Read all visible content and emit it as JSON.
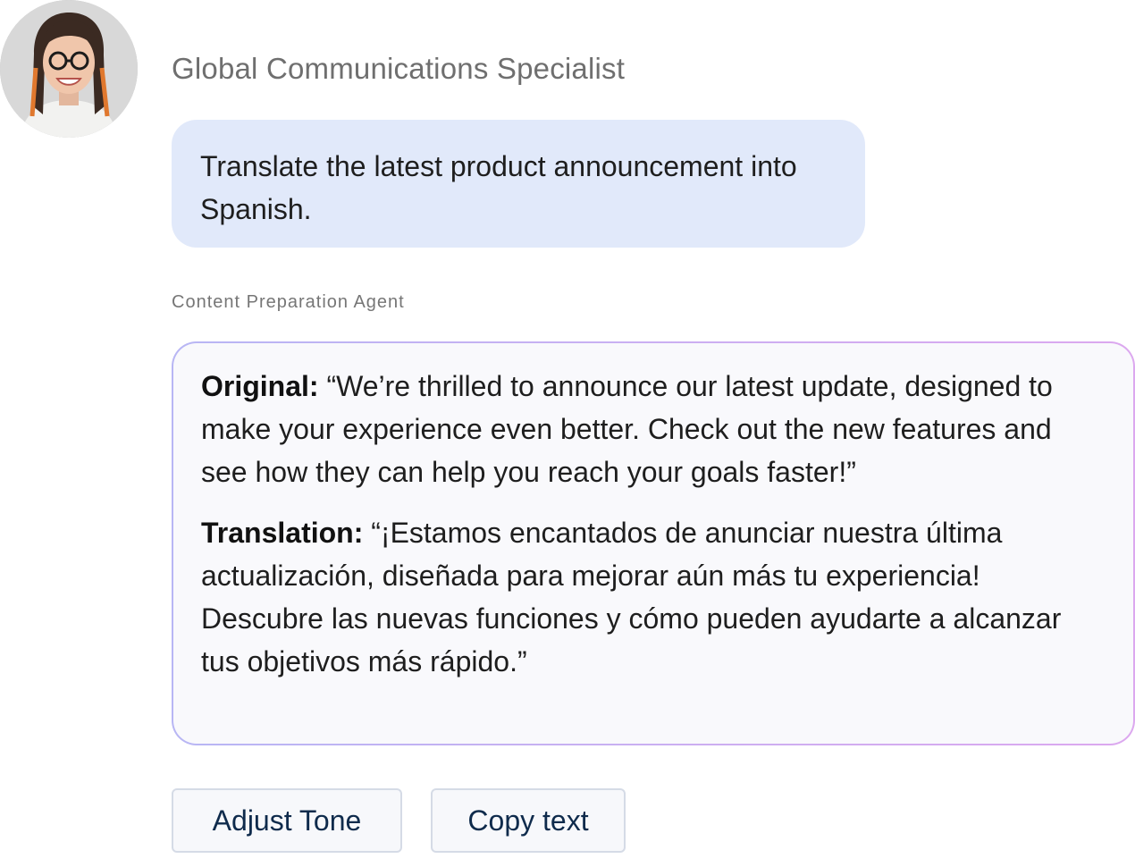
{
  "user": {
    "name": "Global Communications Specialist",
    "avatar_icon": "person-avatar-photo",
    "message": "Translate the latest product announcement into Spanish."
  },
  "agent": {
    "name": "Content Preparation Agent",
    "original_label": "Original:",
    "original_text": " “We’re thrilled to announce our latest update, designed to make your experience even better. Check out the new features and see how they can help you reach your goals faster!”",
    "translation_label": "Translation:",
    "translation_text": " “¡Estamos encantados de anunciar nuestra última actualización, diseñada para mejorar aún más tu experiencia! Descubre las nuevas funciones y cómo pueden ayudarte a alcanzar tus objetivos más rápido.”"
  },
  "actions": {
    "adjust_tone": "Adjust Tone",
    "copy_text": "Copy text"
  },
  "colors": {
    "user_bubble": "#e1e9fa",
    "agent_border_start": "#b8b6f4",
    "agent_border_end": "#dca8ef",
    "button_text": "#0f2b4c"
  }
}
